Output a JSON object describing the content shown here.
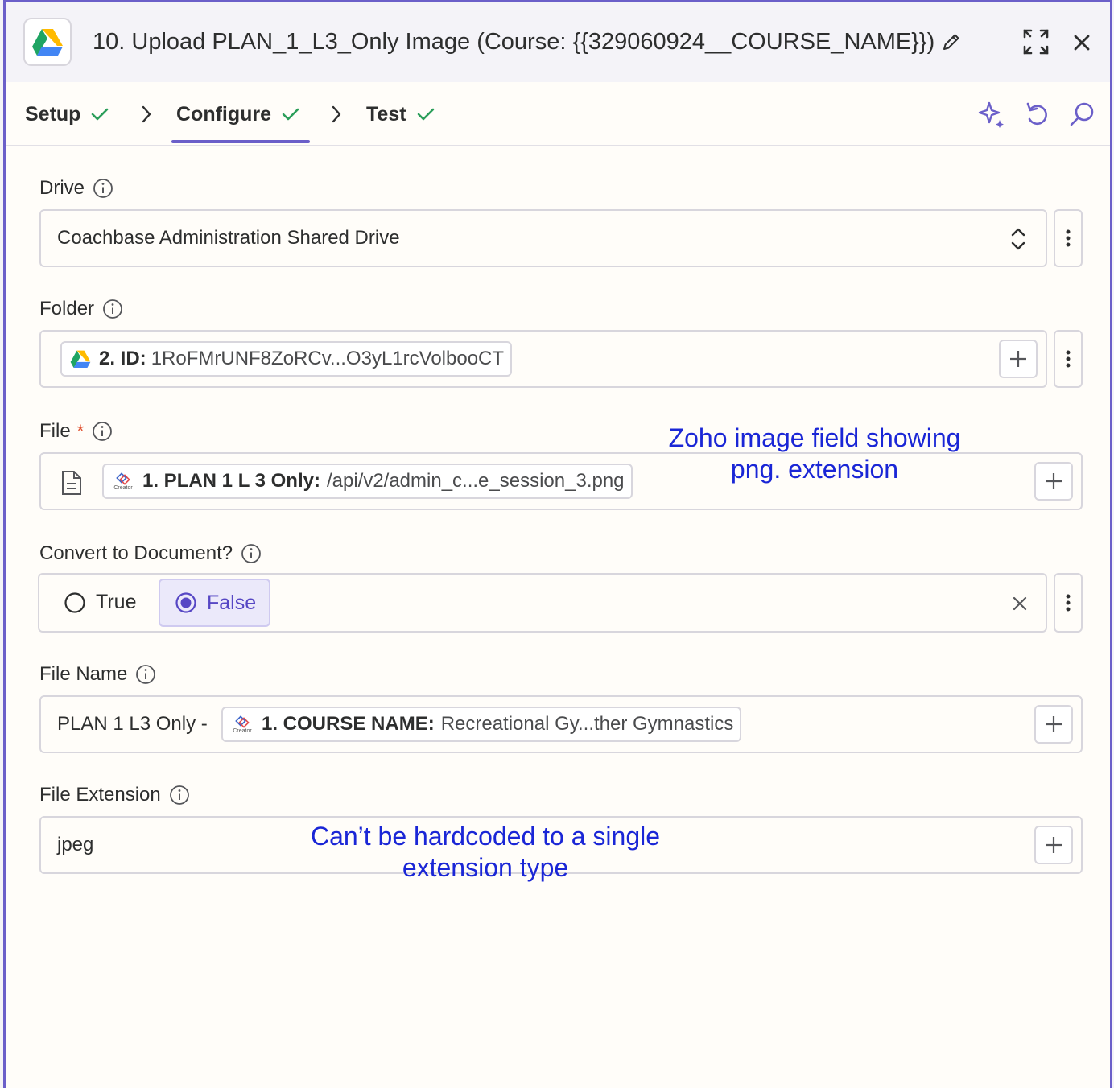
{
  "header": {
    "title": "10. Upload PLAN_1_L3_Only Image (Course: {{329060924__COURSE_NAME}})",
    "app_icon": "google-drive-icon"
  },
  "tabs": [
    {
      "label": "Setup",
      "done": true
    },
    {
      "label": "Configure",
      "done": true,
      "active": true
    },
    {
      "label": "Test",
      "done": true
    }
  ],
  "toolbar_icons": [
    "sparkle-icon",
    "undo-icon",
    "search-icon"
  ],
  "colors": {
    "accent": "#6b5fc9",
    "check": "#2b9e5a",
    "annotation": "#1a26d6"
  },
  "fields": {
    "drive": {
      "label": "Drive",
      "value": "Coachbase Administration Shared Drive"
    },
    "folder": {
      "label": "Folder",
      "pill_key": "2. ID:",
      "pill_value": "1RoFMrUNF8ZoRCv...O3yL1rcVolbooCT"
    },
    "file": {
      "label": "File",
      "required": "*",
      "pill_key": "1. PLAN 1 L 3 Only:",
      "pill_value": "/api/v2/admin_c...e_session_3.png",
      "creator_text": "Creator"
    },
    "convert": {
      "label": "Convert to Document?",
      "options": [
        "True",
        "False"
      ],
      "selected": "False"
    },
    "file_name": {
      "label": "File Name",
      "prefix": "PLAN 1 L3 Only -",
      "pill_key": "1. COURSE NAME:",
      "pill_value": "Recreational Gy...ther Gymnastics",
      "creator_text": "Creator"
    },
    "file_extension": {
      "label": "File Extension",
      "value": "jpeg"
    }
  },
  "annotations": {
    "file_note_line1": "Zoho image field showing",
    "file_note_line2": "png. extension",
    "ext_note_line1": "Can’t be hardcoded to a single",
    "ext_note_line2": "extension type"
  }
}
